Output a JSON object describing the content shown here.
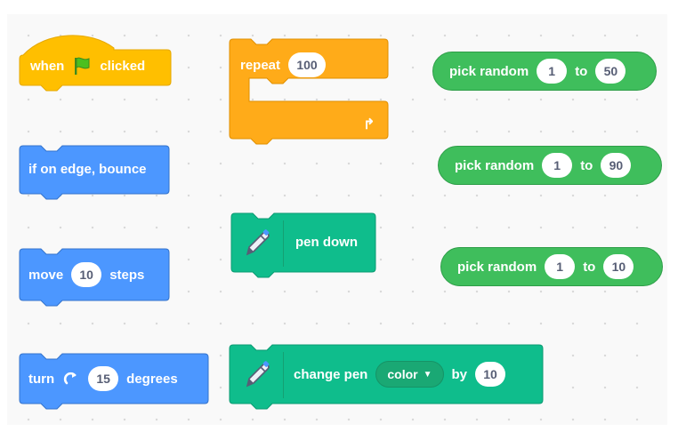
{
  "colors": {
    "events": "#ffbf00",
    "control": "#ffab19",
    "motion": "#4c97ff",
    "pen": "#0fbd8c",
    "operators": "#59c059"
  },
  "when_flag": {
    "label_before": "when",
    "icon": "green-flag-icon",
    "label_after": "clicked"
  },
  "repeat_block": {
    "label": "repeat",
    "value": "100",
    "loop_icon": "loop-arrow-icon"
  },
  "bounce_block": {
    "label": "if on edge, bounce"
  },
  "pen_down_block": {
    "icon": "pen-icon",
    "label": "pen down"
  },
  "move_block": {
    "label_before": "move",
    "value": "10",
    "label_after": "steps"
  },
  "turn_block": {
    "label_before": "turn",
    "icon": "rotate-clockwise-icon",
    "value": "15",
    "label_after": "degrees"
  },
  "change_pen_block": {
    "icon": "pen-icon",
    "label": "change pen",
    "dropdown": "color",
    "label_by": "by",
    "value": "10"
  },
  "random_blocks": [
    {
      "label": "pick random",
      "from": "1",
      "to_label": "to",
      "to": "50"
    },
    {
      "label": "pick random",
      "from": "1",
      "to_label": "to",
      "to": "90"
    },
    {
      "label": "pick random",
      "from": "1",
      "to_label": "to",
      "to": "10"
    }
  ]
}
